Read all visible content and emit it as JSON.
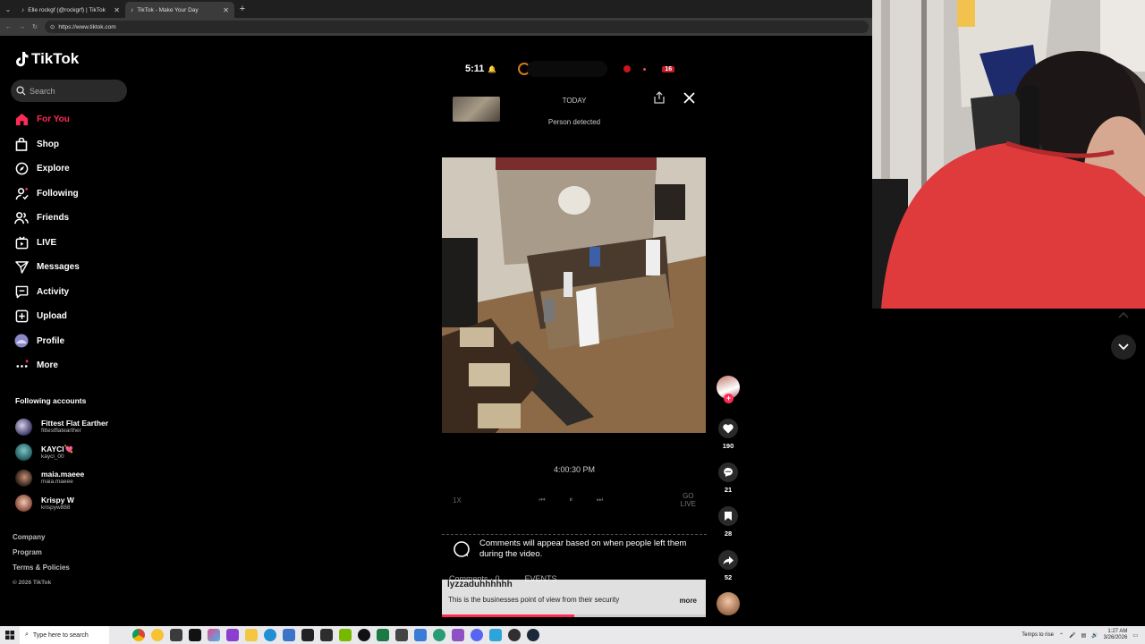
{
  "browser": {
    "tabs": [
      {
        "title": "Elle rockgf (@rockgrf) | TikTok",
        "active": false
      },
      {
        "title": "TikTok - Make Your Day",
        "active": true
      }
    ],
    "url": "https://www.tiktok.com"
  },
  "sidebar": {
    "logo": "TikTok",
    "search_placeholder": "Search",
    "nav": [
      {
        "label": "For You",
        "icon": "home-icon",
        "active": true
      },
      {
        "label": "Shop",
        "icon": "shop-icon"
      },
      {
        "label": "Explore",
        "icon": "compass-icon"
      },
      {
        "label": "Following",
        "icon": "following-icon"
      },
      {
        "label": "Friends",
        "icon": "friends-icon"
      },
      {
        "label": "LIVE",
        "icon": "live-icon"
      },
      {
        "label": "Messages",
        "icon": "messages-icon"
      },
      {
        "label": "Activity",
        "icon": "activity-icon"
      },
      {
        "label": "Upload",
        "icon": "upload-icon"
      },
      {
        "label": "Profile",
        "icon": "profile-icon"
      },
      {
        "label": "More",
        "icon": "more-icon"
      }
    ],
    "following_title": "Following accounts",
    "accounts": [
      {
        "name": "Fittest Flat Earther",
        "handle": "fittestflatearther"
      },
      {
        "name": "KAYCI💘",
        "handle": "kayci_00"
      },
      {
        "name": "maia.maeee",
        "handle": "maia.maeee"
      },
      {
        "name": "Krispy W",
        "handle": "krispyw888"
      }
    ],
    "footer": [
      "Company",
      "Program",
      "Terms & Policies"
    ],
    "copyright": "© 2026 TikTok"
  },
  "video": {
    "phone_time": "5:11",
    "battery": "16",
    "today_label": "TODAY",
    "event_label": "Person detected",
    "camera_time": "4:00:30 PM",
    "speed": "1X",
    "go_live": [
      "GO",
      "LIVE"
    ],
    "comment_notice": "Comments will appear based on when people left them during the video.",
    "comments_tab": "Comments · 0",
    "events_tab": "EVENTS",
    "username": "lyzzaduhhhhhh",
    "caption": "This is the businesses point of view from their security",
    "more": "more",
    "progress": 0.5
  },
  "actions": {
    "likes": "190",
    "comments": "21",
    "saves": "28",
    "shares": "52"
  },
  "colors": {
    "accent": "#fe2c55",
    "background": "#000000"
  },
  "taskbar": {
    "search_placeholder": "Type here to search",
    "weather": "Temps to rise",
    "time": "1:27 AM",
    "date": "3/26/2026"
  }
}
